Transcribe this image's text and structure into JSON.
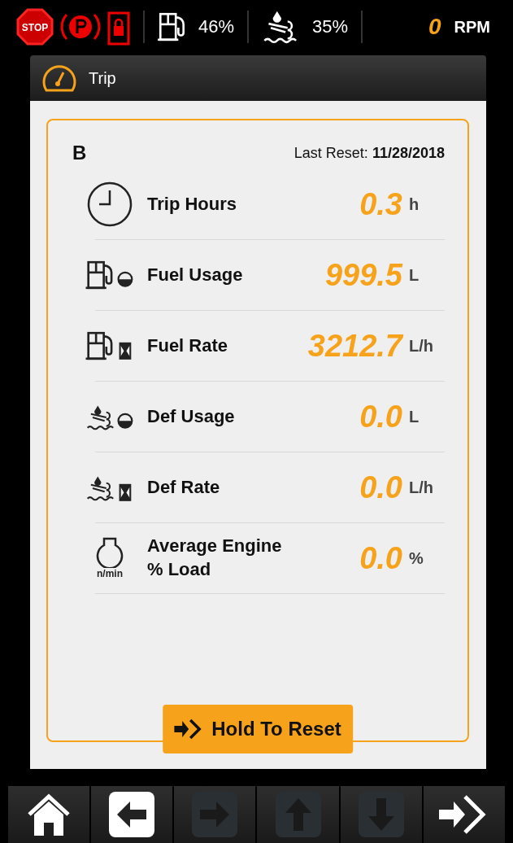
{
  "status_bar": {
    "stop_label": "STOP",
    "fuel_level": "46%",
    "def_level": "35%",
    "rpm_value": "0",
    "rpm_unit": "RPM"
  },
  "panel": {
    "title": "Trip"
  },
  "trip": {
    "name": "B",
    "last_reset_label": "Last Reset:",
    "last_reset_date": "11/28/2018",
    "rows": [
      {
        "kind": "clock",
        "label": "Trip Hours",
        "value": "0.3",
        "unit": "h"
      },
      {
        "kind": "fuel-level",
        "label": "Fuel Usage",
        "value": "999.5",
        "unit": "L"
      },
      {
        "kind": "fuel-rate",
        "label": "Fuel Rate",
        "value": "3212.7",
        "unit": "L/h"
      },
      {
        "kind": "def-level",
        "label": "Def Usage",
        "value": "0.0",
        "unit": "L"
      },
      {
        "kind": "def-rate",
        "label": "Def Rate",
        "value": "0.0",
        "unit": "L/h"
      },
      {
        "kind": "engine",
        "label": "Average Engine\n% Load",
        "value": "0.0",
        "unit": "%",
        "icon_caption": "n/min"
      }
    ],
    "reset_button": "Hold To Reset"
  },
  "nav": [
    {
      "kind": "home",
      "disabled": false
    },
    {
      "kind": "back",
      "disabled": false
    },
    {
      "kind": "forward",
      "disabled": true
    },
    {
      "kind": "up",
      "disabled": true
    },
    {
      "kind": "down",
      "disabled": true
    },
    {
      "kind": "enter",
      "disabled": false
    }
  ]
}
